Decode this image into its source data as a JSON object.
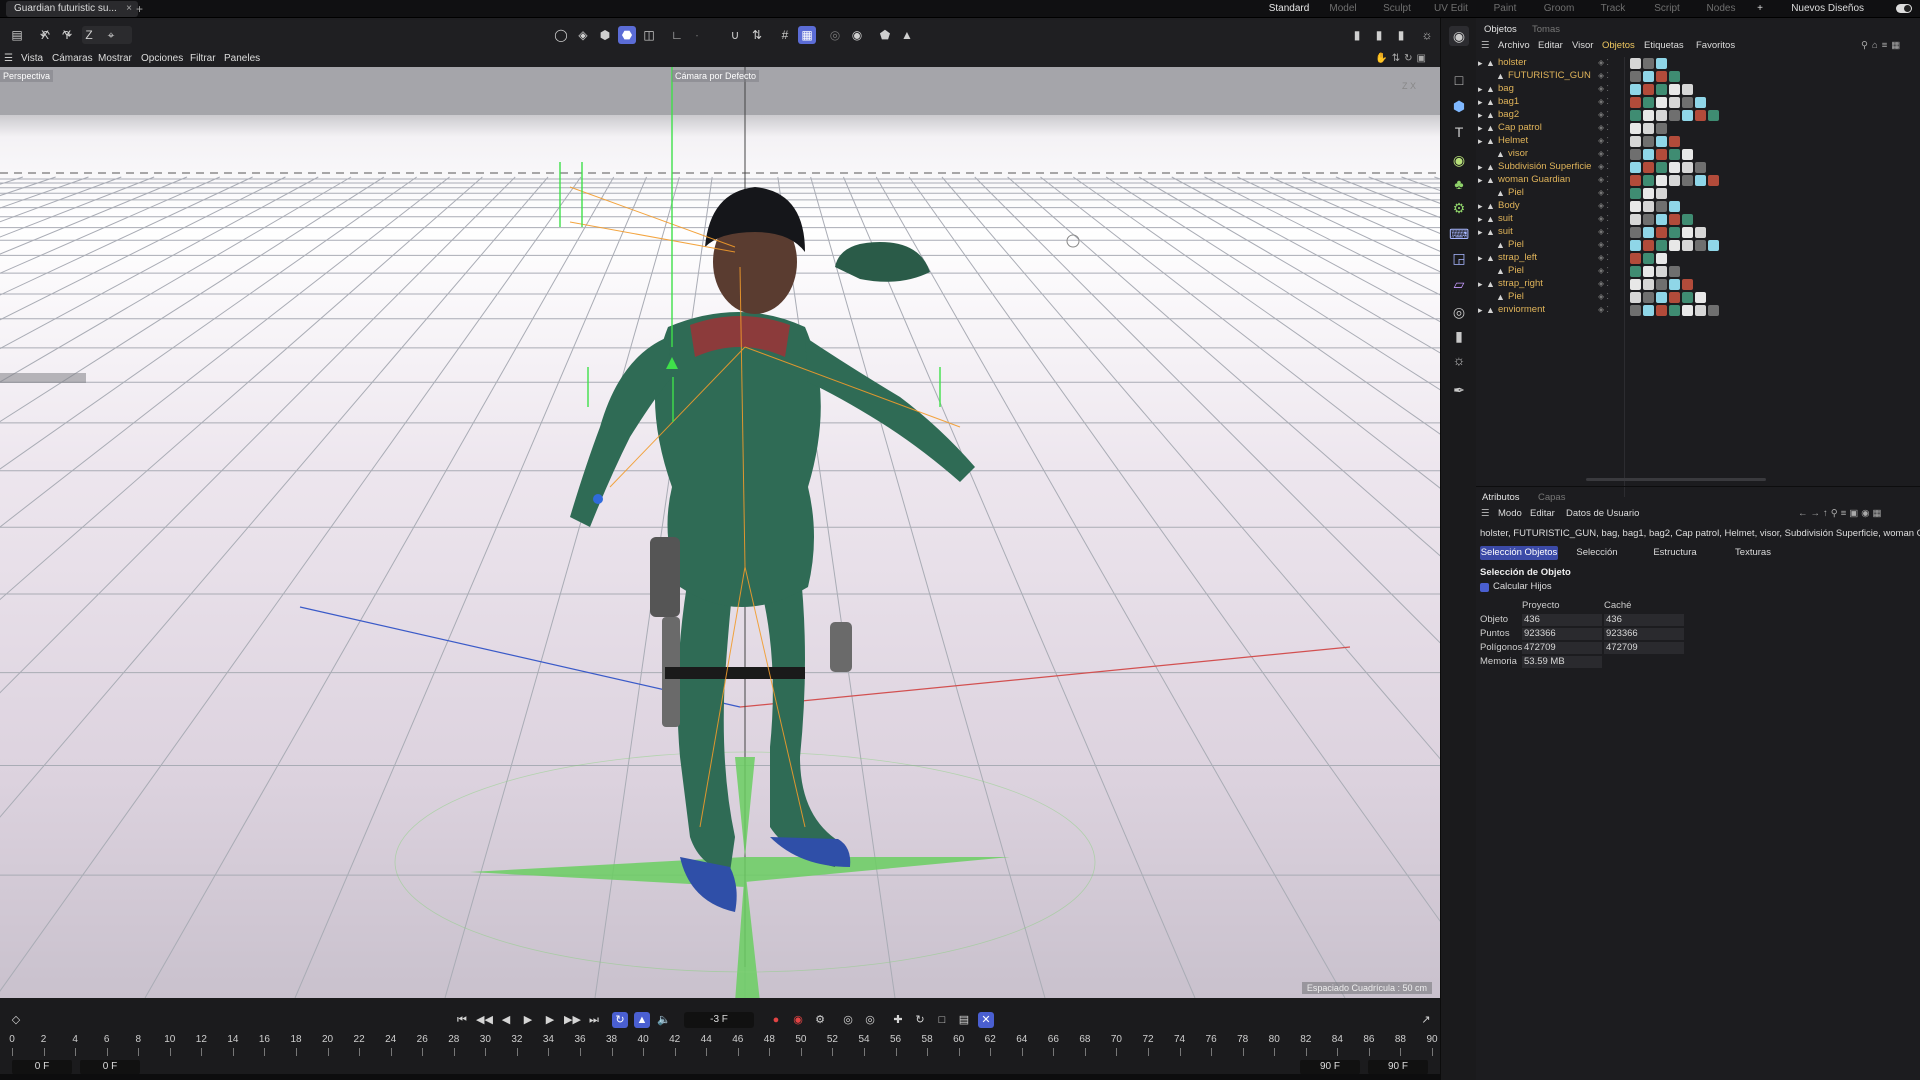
{
  "window": {
    "doc_tab": "Guardian futuristic su...",
    "close": "×",
    "add": "+",
    "layouts": [
      "Standard",
      "Model",
      "Sculpt",
      "UV Edit",
      "Paint",
      "Groom",
      "Track",
      "Script",
      "Nodes"
    ],
    "active_layout": "Standard",
    "add_layout": "+",
    "new_layouts": "Nuevos Diseños"
  },
  "axes": {
    "x": "X",
    "y": "Y",
    "z": "Z"
  },
  "viewport_menu": [
    "Vista",
    "Cámaras",
    "Mostrar",
    "Opciones",
    "Filtrar",
    "Paneles"
  ],
  "viewport": {
    "label": "Perspectiva",
    "camera": "Cámara por Defecto",
    "grid_spacing": "Espaciado Cuadrícula : 50 cm"
  },
  "timeline": {
    "current_frame": "-3 F",
    "ticks": [
      "0",
      "2",
      "4",
      "6",
      "8",
      "10",
      "12",
      "14",
      "16",
      "18",
      "20",
      "22",
      "24",
      "26",
      "28",
      "30",
      "32",
      "34",
      "36",
      "38",
      "40",
      "42",
      "44",
      "46",
      "48",
      "50",
      "52",
      "54",
      "56",
      "58",
      "60",
      "62",
      "64",
      "66",
      "68",
      "70",
      "72",
      "74",
      "76",
      "78",
      "80",
      "82",
      "84",
      "86",
      "88",
      "90"
    ],
    "range_start_a": "0 F",
    "range_start_b": "0 F",
    "range_end_a": "90 F",
    "range_end_b": "90 F"
  },
  "objects_panel": {
    "tabs": [
      "Objetos",
      "Tomas"
    ],
    "menu": [
      "Archivo",
      "Editar",
      "Visor",
      "Objetos",
      "Etiquetas",
      "Favoritos"
    ],
    "active_menu": "Objetos",
    "items": [
      {
        "name": "holster",
        "indent": 0,
        "color": "orange"
      },
      {
        "name": "FUTURISTIC_GUN",
        "indent": 1,
        "color": "orange"
      },
      {
        "name": "bag",
        "indent": 0,
        "color": "orange"
      },
      {
        "name": "bag1",
        "indent": 0,
        "color": "orange"
      },
      {
        "name": "bag2",
        "indent": 0,
        "color": "orange"
      },
      {
        "name": "Cap patrol",
        "indent": 0,
        "color": "orange"
      },
      {
        "name": "Helmet",
        "indent": 0,
        "color": "orange"
      },
      {
        "name": "visor",
        "indent": 1,
        "color": "orange"
      },
      {
        "name": "Subdivisión Superficie",
        "indent": 0,
        "color": "orange"
      },
      {
        "name": "woman Guardian",
        "indent": 0,
        "color": "orange"
      },
      {
        "name": "Piel",
        "indent": 1,
        "color": "orange"
      },
      {
        "name": "Body",
        "indent": 0,
        "color": "orange"
      },
      {
        "name": "suit",
        "indent": 0,
        "color": "orange"
      },
      {
        "name": "suit",
        "indent": 0,
        "color": "orange"
      },
      {
        "name": "Piel",
        "indent": 1,
        "color": "orange"
      },
      {
        "name": "strap_left",
        "indent": 0,
        "color": "orange"
      },
      {
        "name": "Piel",
        "indent": 1,
        "color": "orange"
      },
      {
        "name": "strap_right",
        "indent": 0,
        "color": "orange"
      },
      {
        "name": "Piel",
        "indent": 1,
        "color": "orange"
      },
      {
        "name": "enviorment",
        "indent": 0,
        "color": "orange"
      }
    ]
  },
  "attributes_panel": {
    "tabs": [
      "Atributos",
      "Capas"
    ],
    "menu": [
      "Modo",
      "Editar",
      "Datos de Usuario"
    ],
    "path": "holster, FUTURISTIC_GUN, bag, bag1, bag2, Cap patrol, Helmet, visor, Subdivisión Superficie, woman Guard",
    "subtabs": [
      "Selección Objetos",
      "Selección",
      "Estructura",
      "Texturas"
    ],
    "section_title": "Selección de Objeto",
    "checkbox_label": "Calcular Hijos",
    "col_project": "Proyecto",
    "col_cache": "Caché",
    "stats": [
      {
        "label": "Objeto",
        "project": "436",
        "cache": "436"
      },
      {
        "label": "Puntos",
        "project": "923366",
        "cache": "923366"
      },
      {
        "label": "Polígonos",
        "project": "472709",
        "cache": "472709"
      },
      {
        "label": "Memoria",
        "project": "53.59 MB",
        "cache": ""
      }
    ]
  },
  "colors": {
    "accent": "#5b6cd6",
    "object_name": "#e0b45a",
    "suit": "#2f6b55",
    "grid_line": "#9aa0a8"
  }
}
